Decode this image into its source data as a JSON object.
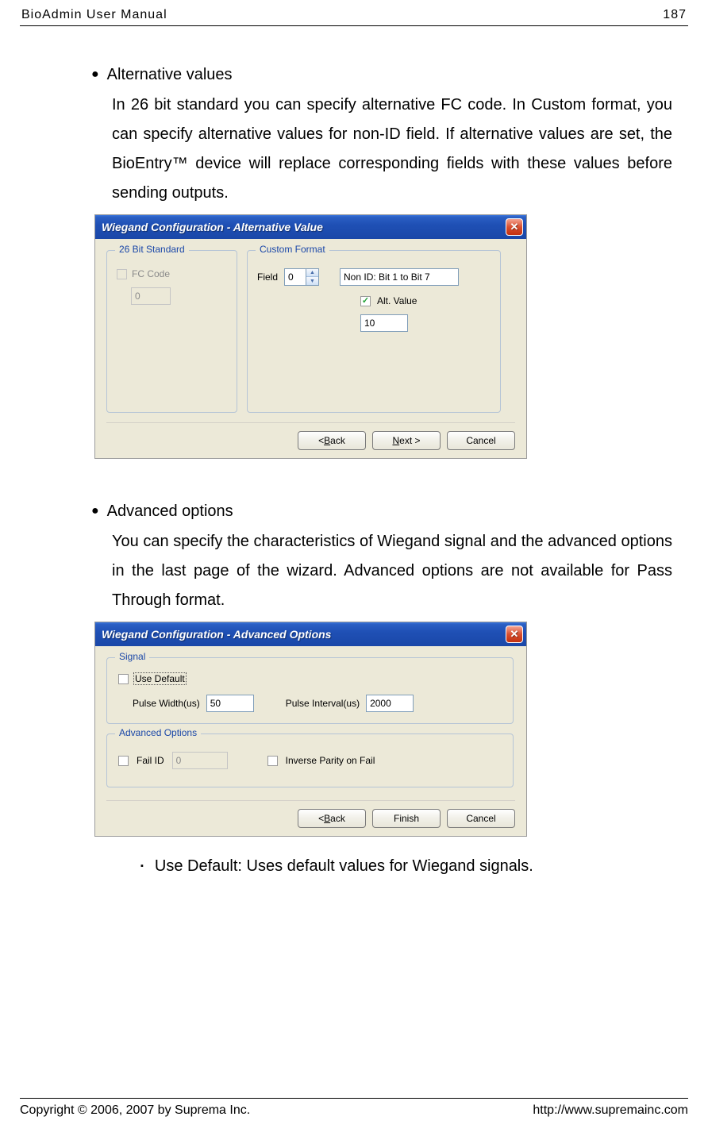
{
  "header": {
    "left": "BioAdmin  User  Manual",
    "right": "187"
  },
  "section1": {
    "heading": "Alternative values",
    "body": "In 26 bit standard you can specify alternative FC code. In Custom format, you can specify alternative values for non-ID field. If alternative values are set, the BioEntry™ device will replace corresponding fields with these values before sending outputs."
  },
  "dialog1": {
    "title": "Wiegand Configuration - Alternative Value",
    "group_std": {
      "legend": "26 Bit Standard",
      "fc_label": "FC Code",
      "fc_value": "0"
    },
    "group_custom": {
      "legend": "Custom Format",
      "field_label": "Field",
      "field_value": "0",
      "nonid_text": "Non ID: Bit 1 to Bit 7",
      "altvalue_label": "Alt. Value",
      "altvalue_input": "10"
    },
    "buttons": {
      "back": "< Back",
      "next": "Next >",
      "cancel": "Cancel"
    }
  },
  "section2": {
    "heading": "Advanced options",
    "body": "You can specify the characteristics of Wiegand signal and the advanced options in the last page of the wizard. Advanced options are not available for Pass Through format."
  },
  "dialog2": {
    "title": "Wiegand Configuration - Advanced Options",
    "signal": {
      "legend": "Signal",
      "use_default": "Use Default",
      "pw_label": "Pulse Width(us)",
      "pw_value": "50",
      "pi_label": "Pulse Interval(us)",
      "pi_value": "2000"
    },
    "adv": {
      "legend": "Advanced Options",
      "failid_label": "Fail ID",
      "failid_value": "0",
      "inverse_label": "Inverse Parity on Fail"
    },
    "buttons": {
      "back": "< Back",
      "finish": "Finish",
      "cancel": "Cancel"
    }
  },
  "sub_bullet": "Use Default: Uses default values for Wiegand signals.",
  "footer": {
    "left": "Copyright © 2006, 2007 by Suprema Inc.",
    "right": "http://www.supremainc.com"
  }
}
